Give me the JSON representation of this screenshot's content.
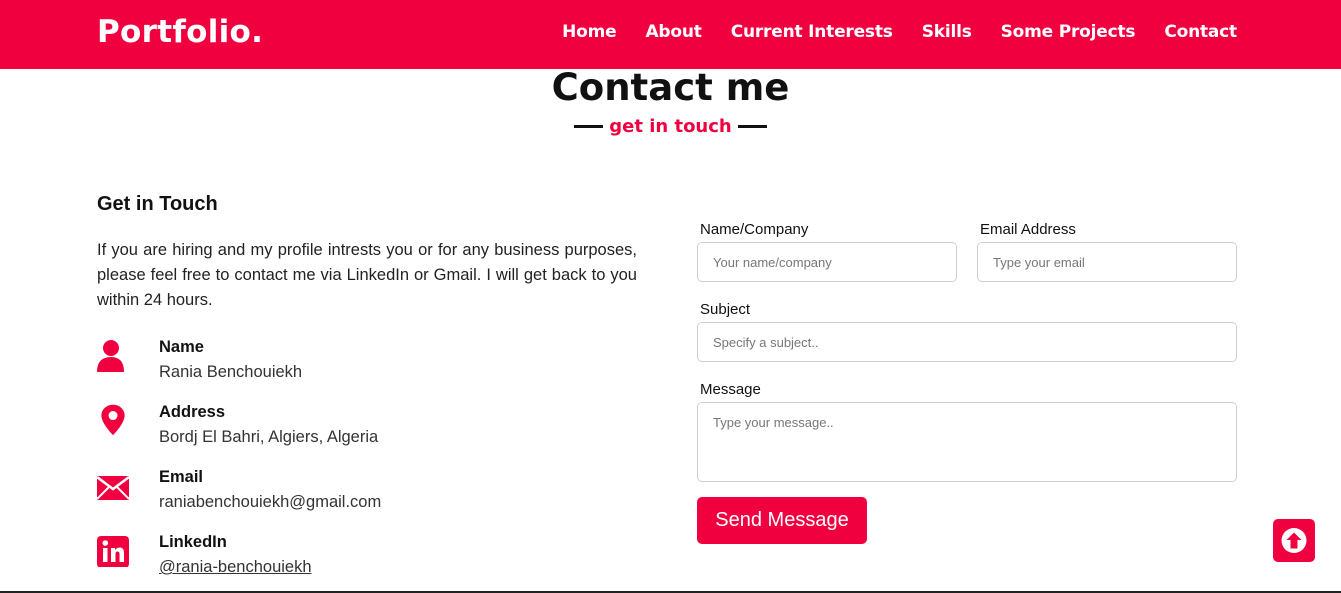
{
  "brand": "Portfolio.",
  "nav": [
    "Home",
    "About",
    "Current Interests",
    "Skills",
    "Some Projects",
    "Contact"
  ],
  "section": {
    "title": "Contact me",
    "subtitle": "get in touch"
  },
  "getInTouch": {
    "title": "Get in Touch",
    "text": "If you are hiring and my profile intrests you or for any business purposes, please feel free to contact me via LinkedIn or Gmail. I will get back to you within 24 hours."
  },
  "info": [
    {
      "label": "Name",
      "value": "Rania Benchouiekh",
      "icon": "user-icon"
    },
    {
      "label": "Address",
      "value": "Bordj El Bahri, Algiers, Algeria",
      "icon": "map-pin-icon"
    },
    {
      "label": "Email",
      "value": "raniabenchouiekh@gmail.com",
      "icon": "envelope-icon"
    },
    {
      "label": "LinkedIn",
      "value": "@rania-benchouiekh",
      "icon": "linkedin-icon"
    }
  ],
  "form": {
    "name_label": "Name/Company",
    "name_placeholder": "Your name/company",
    "email_label": "Email Address",
    "email_placeholder": "Type your email",
    "subject_label": "Subject",
    "subject_placeholder": "Specify a subject..",
    "message_label": "Message",
    "message_placeholder": "Type your message..",
    "submit": "Send Message"
  },
  "colors": {
    "accent": "#f0003f",
    "text": "#111111"
  }
}
